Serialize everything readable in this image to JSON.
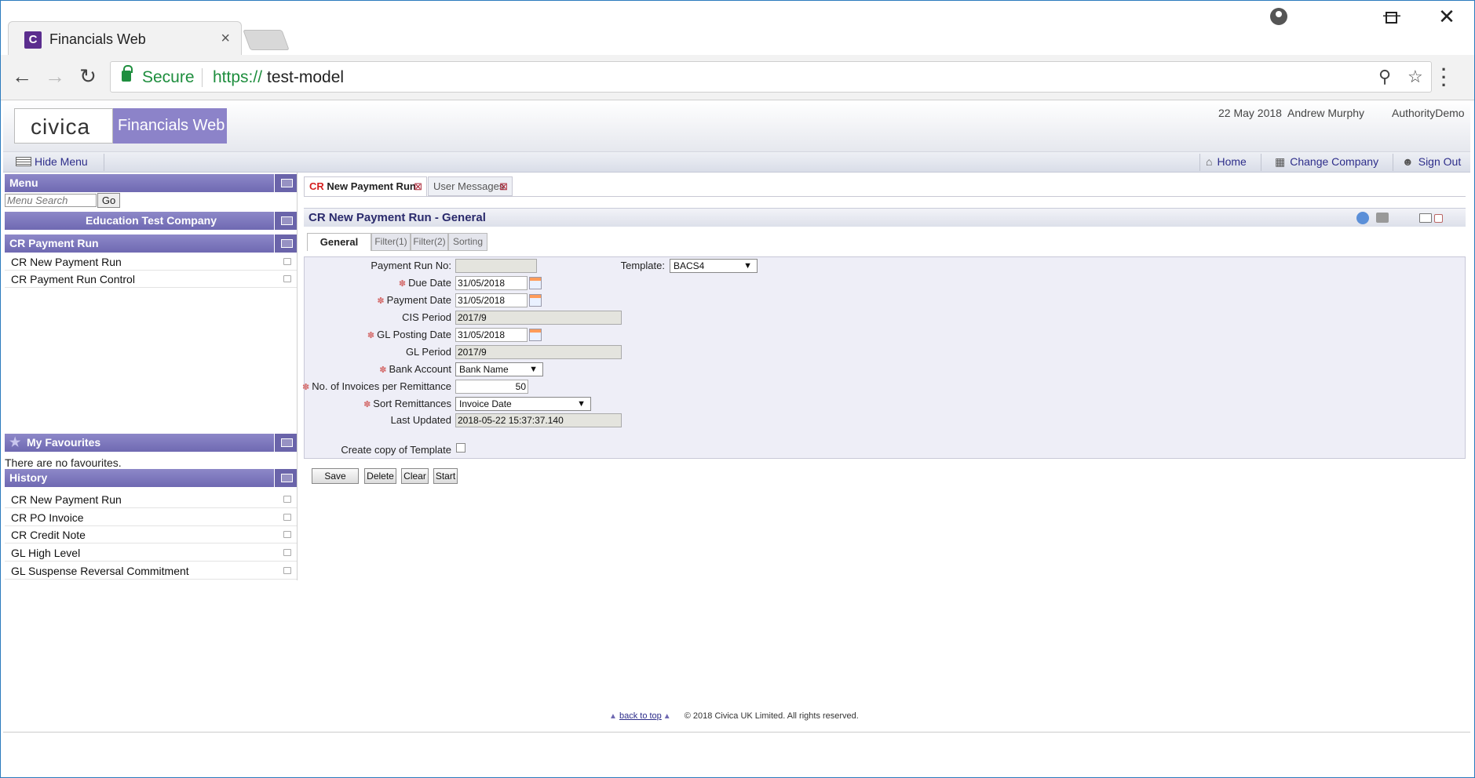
{
  "browser": {
    "tab_title": "Financials Web",
    "tab_favicon": "C",
    "tab_close": "×",
    "secure_label": "Secure",
    "url_scheme": "https://",
    "url_host": "test-model"
  },
  "header": {
    "logo": "civica",
    "product": "Financials Web",
    "date": "22 May 2018",
    "user": "Andrew Murphy",
    "authority": "AuthorityDemo"
  },
  "menubar": {
    "hide_menu": "Hide Menu",
    "home": "Home",
    "change_company": "Change Company",
    "sign_out": "Sign Out"
  },
  "sidebar": {
    "menu_title": "Menu",
    "search_placeholder": "Menu Search",
    "go_label": "Go",
    "company": "Education Test Company",
    "group_title": "CR Payment Run",
    "items": [
      "CR New Payment Run",
      "CR Payment Run Control"
    ],
    "favourites_title": "My Favourites",
    "favourites_empty": "There are no favourites.",
    "history_title": "History",
    "history": [
      "CR New Payment Run",
      "CR PO Invoice",
      "CR Credit Note",
      "GL High Level",
      "GL Suspense Reversal Commitment"
    ]
  },
  "tabs": {
    "active_prefix": "CR",
    "active_label": "New Payment Run",
    "inactive_label": "User Messages",
    "close": "⊠"
  },
  "form": {
    "title": "CR New Payment Run - General",
    "subtabs": [
      "General",
      "Filter(1)",
      "Filter(2)",
      "Sorting"
    ],
    "fields": {
      "payment_run_no": {
        "label": "Payment Run No:",
        "value": ""
      },
      "template": {
        "label": "Template:",
        "value": "BACS4"
      },
      "due_date": {
        "label": "Due Date",
        "value": "31/05/2018"
      },
      "payment_date": {
        "label": "Payment Date",
        "value": "31/05/2018"
      },
      "cis_period": {
        "label": "CIS Period",
        "value": "2017/9"
      },
      "gl_posting_date": {
        "label": "GL Posting Date",
        "value": "31/05/2018"
      },
      "gl_period": {
        "label": "GL Period",
        "value": "2017/9"
      },
      "bank_account": {
        "label": "Bank Account",
        "value": "Bank Name"
      },
      "invoices_per_remittance": {
        "label": "No. of Invoices per Remittance",
        "value": "50"
      },
      "sort_remittances": {
        "label": "Sort Remittances",
        "value": "Invoice Date"
      },
      "last_updated": {
        "label": "Last Updated",
        "value": "2018-05-22 15:37:37.140"
      },
      "create_copy": {
        "label": "Create copy of Template",
        "checked": false
      }
    },
    "required_marker": "✽",
    "buttons": {
      "save": "Save",
      "delete": "Delete",
      "clear": "Clear",
      "start": "Start"
    }
  },
  "footer": {
    "back_to_top": "back to top",
    "copyright": "© 2018 Civica UK Limited. All rights reserved."
  },
  "colors": {
    "brand_purple": "#6f69b2",
    "form_bg": "#eeeef7",
    "secure_green": "#1e8e3e"
  }
}
